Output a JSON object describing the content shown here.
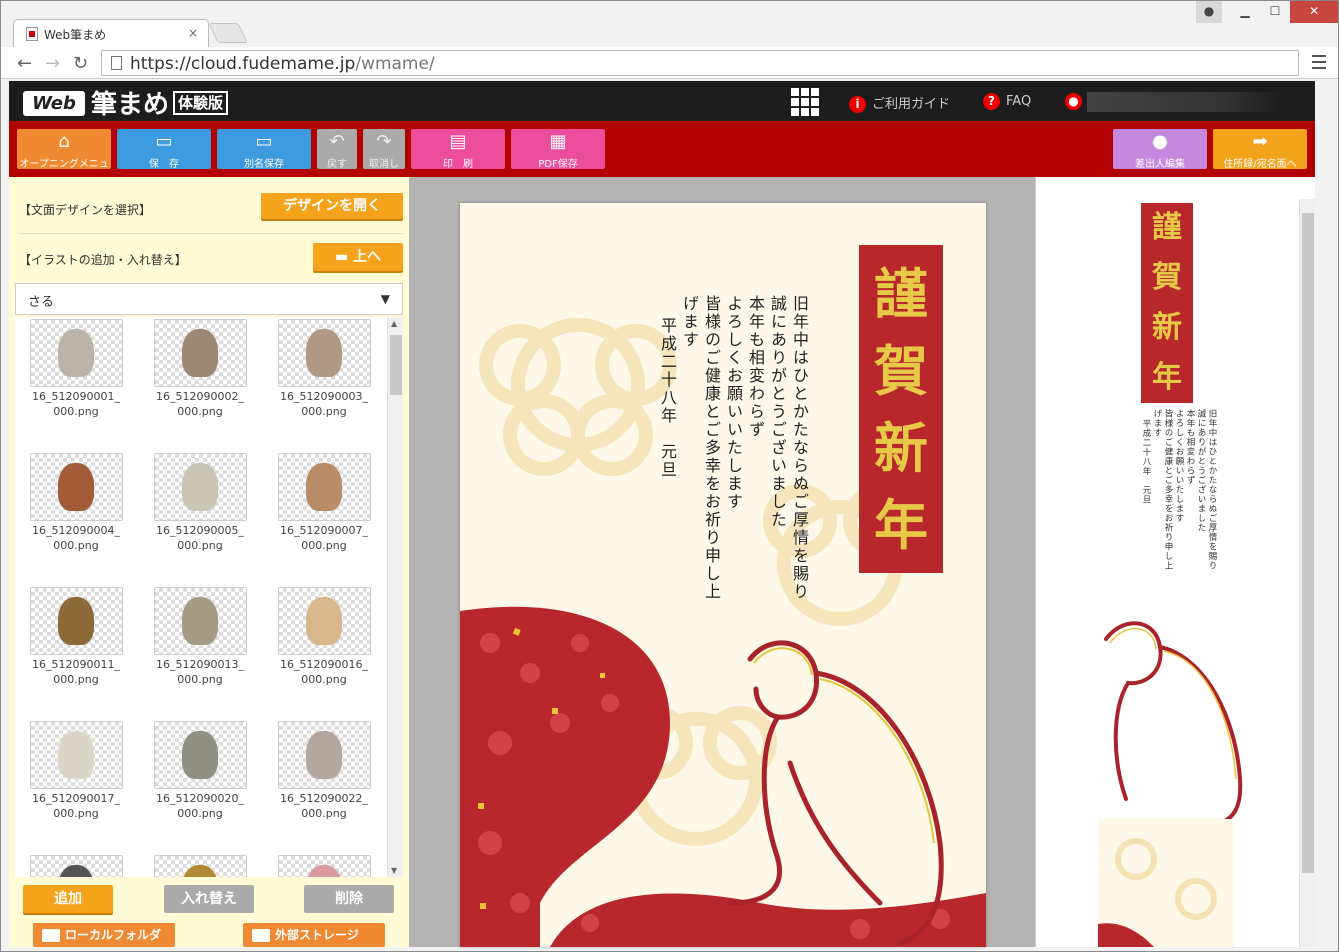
{
  "browser": {
    "tab_title": "Web筆まめ",
    "tab_close": "×",
    "url_host": "https://cloud.fudemame.jp",
    "url_path": "/wmame/",
    "window_controls": {
      "minimize": "▁",
      "maximize": "☐",
      "close": "✕"
    }
  },
  "header": {
    "logo_web": "Web",
    "logo_main": "筆まめ",
    "logo_badge": "体験版",
    "guide_label": "ご利用ガイド",
    "faq_label": "FAQ",
    "guide_icon": "i",
    "faq_icon": "?"
  },
  "toolbar": {
    "opening_menu": "オープニングメニュー",
    "save": "保　存",
    "save_as": "別名保存",
    "undo": "戻す",
    "redo": "取消し",
    "print": "印　刷",
    "pdf_save": "PDF保存",
    "sender_edit": "差出人編集",
    "address_screen": "住所録/宛名面へ"
  },
  "left_panel": {
    "design_label": "【文面デザインを選択】",
    "design_button": "デザインを開く",
    "illust_label": "【イラストの追加・入れ替え】",
    "up_button": "上へ",
    "category_select": "さる",
    "items": [
      {
        "name": "16_512090001_000.png",
        "color": "#b9b4a7"
      },
      {
        "name": "16_512090002_000.png",
        "color": "#9c8875"
      },
      {
        "name": "16_512090003_000.png",
        "color": "#b09a85"
      },
      {
        "name": "16_512090004_000.png",
        "color": "#a35b3a"
      },
      {
        "name": "16_512090005_000.png",
        "color": "#c9c5b5"
      },
      {
        "name": "16_512090007_000.png",
        "color": "#b88c66"
      },
      {
        "name": "16_512090011_000.png",
        "color": "#8d6a3a"
      },
      {
        "name": "16_512090013_000.png",
        "color": "#a59c86"
      },
      {
        "name": "16_512090016_000.png",
        "color": "#d6b88c"
      },
      {
        "name": "16_512090017_000.png",
        "color": "#d9d6c8"
      },
      {
        "name": "16_512090020_000.png",
        "color": "#8f8f84"
      },
      {
        "name": "16_512090022_000.png",
        "color": "#b3a7a0"
      },
      {
        "name": "",
        "color": "#555555"
      },
      {
        "name": "",
        "color": "#b08a35"
      },
      {
        "name": "",
        "color": "#d99aa0"
      }
    ],
    "add_button": "追加",
    "replace_button": "入れ替え",
    "delete_button": "削除",
    "local_folder_button": "ローカルフォルダ",
    "external_storage_button": "外部ストレージ"
  },
  "card": {
    "title_chars": [
      "謹",
      "賀",
      "新",
      "年"
    ],
    "lines": [
      "旧年中はひとかたならぬご厚情を賜り",
      "誠にありがとうございました",
      "本年も相変わらず",
      "よろしくお願いいたします",
      "皆様のご健康とご多幸をお祈り申し上",
      "げます",
      "平成二十八年　元旦"
    ],
    "colors": {
      "red": "#b8272b",
      "gold": "#e7c948",
      "paper": "#fdf8e8"
    }
  }
}
